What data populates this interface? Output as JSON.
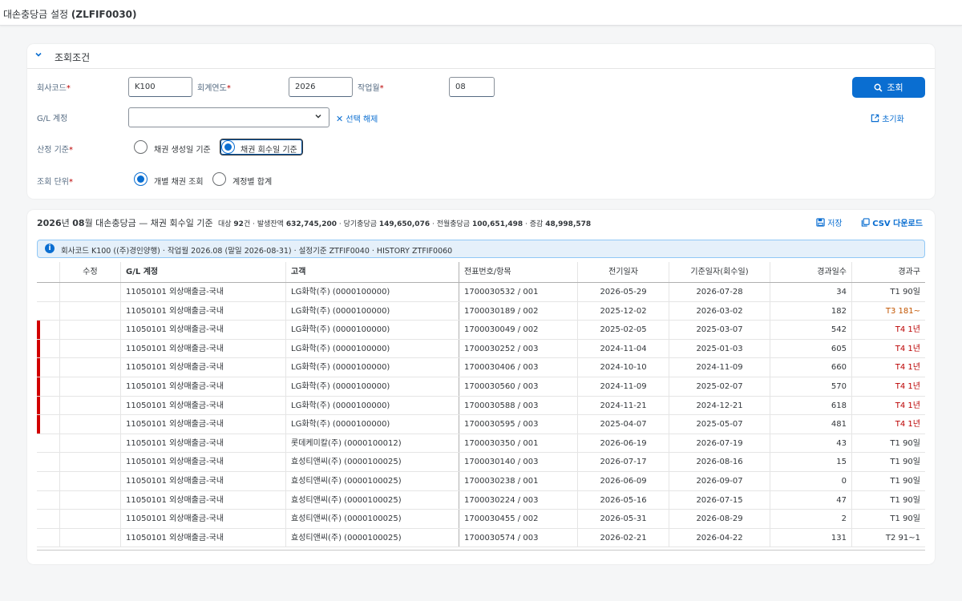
{
  "app": {
    "title_main": "대손충당금 설정 ",
    "title_code": "(ZLFIF0030)"
  },
  "filter": {
    "title": "조회조건",
    "company_code_label": "회사코드",
    "company_code_value": "K100",
    "fiscal_year_label": "회계연도",
    "fiscal_year_value": "2026",
    "work_month_label": "작업월",
    "work_month_value": "08",
    "gl_label": "G/L 계정",
    "gl_value": "",
    "clear_label": "선택 해제",
    "basis_label": "산정 기준",
    "basis_options": [
      "채권 생성일 기준",
      "채권 회수일 기준"
    ],
    "basis_selected": "채권 회수일 기준",
    "unit_label": "조회 단위",
    "unit_options": [
      "개별 채권 조회",
      "계정별 합계"
    ],
    "unit_selected": "개별 채권 조회",
    "search_label": "조회",
    "reset_label": "초기화"
  },
  "results": {
    "title_year": "2026",
    "title_year_unit": "년 ",
    "title_month": "08",
    "title_month_unit": "월 대손충당금 — 채권 회수일 기준",
    "meta_target_label": "대상",
    "meta_target_value": "92",
    "meta_target_unit": "건 · 발생잔액",
    "meta_balance": "632,745,200",
    "meta_current_label": "· 당기충당금",
    "meta_current": "149,650,076",
    "meta_prev_label": "· 전월충당금",
    "meta_prev": "100,651,498",
    "meta_diff_label": "· 증감",
    "meta_diff": "48,998,578",
    "save_label": "저장",
    "csv_label": "CSV 다운로드",
    "info_text": "회사코드 K100 ((주)경인양행) · 작업월 2026.08 (말일 2026-08-31) · 설정기준 ZTFIF0040 · HISTORY ZTFIF0060"
  },
  "table": {
    "columns": [
      "수정",
      "G/L 계정",
      "고객",
      "전표번호/항목",
      "전기일자",
      "기준일자(회수일)",
      "경과일수",
      "경과구"
    ],
    "rows": [
      {
        "flag": false,
        "gl": "11050101 외상매출금-국내",
        "customer": "LG화학(주) (0000100000)",
        "doc": "1700030532 / 001",
        "posting": "2026-05-29",
        "base": "2026-07-28",
        "days": "34",
        "grade": "T1 90일",
        "level": "t1"
      },
      {
        "flag": false,
        "gl": "11050101 외상매출금-국내",
        "customer": "LG화학(주) (0000100000)",
        "doc": "1700030189 / 002",
        "posting": "2025-12-02",
        "base": "2026-03-02",
        "days": "182",
        "grade": "T3 181~",
        "level": "t3"
      },
      {
        "flag": true,
        "gl": "11050101 외상매출금-국내",
        "customer": "LG화학(주) (0000100000)",
        "doc": "1700030049 / 002",
        "posting": "2025-02-05",
        "base": "2025-03-07",
        "days": "542",
        "grade": "T4 1년",
        "level": "t4"
      },
      {
        "flag": true,
        "gl": "11050101 외상매출금-국내",
        "customer": "LG화학(주) (0000100000)",
        "doc": "1700030252 / 003",
        "posting": "2024-11-04",
        "base": "2025-01-03",
        "days": "605",
        "grade": "T4 1년",
        "level": "t4"
      },
      {
        "flag": true,
        "gl": "11050101 외상매출금-국내",
        "customer": "LG화학(주) (0000100000)",
        "doc": "1700030406 / 003",
        "posting": "2024-10-10",
        "base": "2024-11-09",
        "days": "660",
        "grade": "T4 1년",
        "level": "t4"
      },
      {
        "flag": true,
        "gl": "11050101 외상매출금-국내",
        "customer": "LG화학(주) (0000100000)",
        "doc": "1700030560 / 003",
        "posting": "2024-11-09",
        "base": "2025-02-07",
        "days": "570",
        "grade": "T4 1년",
        "level": "t4"
      },
      {
        "flag": true,
        "gl": "11050101 외상매출금-국내",
        "customer": "LG화학(주) (0000100000)",
        "doc": "1700030588 / 003",
        "posting": "2024-11-21",
        "base": "2024-12-21",
        "days": "618",
        "grade": "T4 1년",
        "level": "t4"
      },
      {
        "flag": true,
        "gl": "11050101 외상매출금-국내",
        "customer": "LG화학(주) (0000100000)",
        "doc": "1700030595 / 003",
        "posting": "2025-04-07",
        "base": "2025-05-07",
        "days": "481",
        "grade": "T4 1년",
        "level": "t4"
      },
      {
        "flag": false,
        "gl": "11050101 외상매출금-국내",
        "customer": "롯데케미칼(주) (0000100012)",
        "doc": "1700030350 / 001",
        "posting": "2026-06-19",
        "base": "2026-07-19",
        "days": "43",
        "grade": "T1 90일",
        "level": "t1"
      },
      {
        "flag": false,
        "gl": "11050101 외상매출금-국내",
        "customer": "효성티앤씨(주) (0000100025)",
        "doc": "1700030140 / 003",
        "posting": "2026-07-17",
        "base": "2026-08-16",
        "days": "15",
        "grade": "T1 90일",
        "level": "t1"
      },
      {
        "flag": false,
        "gl": "11050101 외상매출금-국내",
        "customer": "효성티앤씨(주) (0000100025)",
        "doc": "1700030238 / 001",
        "posting": "2026-06-09",
        "base": "2026-09-07",
        "days": "0",
        "grade": "T1 90일",
        "level": "t1"
      },
      {
        "flag": false,
        "gl": "11050101 외상매출금-국내",
        "customer": "효성티앤씨(주) (0000100025)",
        "doc": "1700030224 / 003",
        "posting": "2026-05-16",
        "base": "2026-07-15",
        "days": "47",
        "grade": "T1 90일",
        "level": "t1"
      },
      {
        "flag": false,
        "gl": "11050101 외상매출금-국내",
        "customer": "효성티앤씨(주) (0000100025)",
        "doc": "1700030455 / 002",
        "posting": "2026-05-31",
        "base": "2026-08-29",
        "days": "2",
        "grade": "T1 90일",
        "level": "t1"
      },
      {
        "flag": false,
        "gl": "11050101 외상매출금-국내",
        "customer": "효성티앤씨(주) (0000100025)",
        "doc": "1700030574 / 003",
        "posting": "2026-02-21",
        "base": "2026-04-22",
        "days": "131",
        "grade": "T2 91~1",
        "level": "t2"
      }
    ]
  }
}
